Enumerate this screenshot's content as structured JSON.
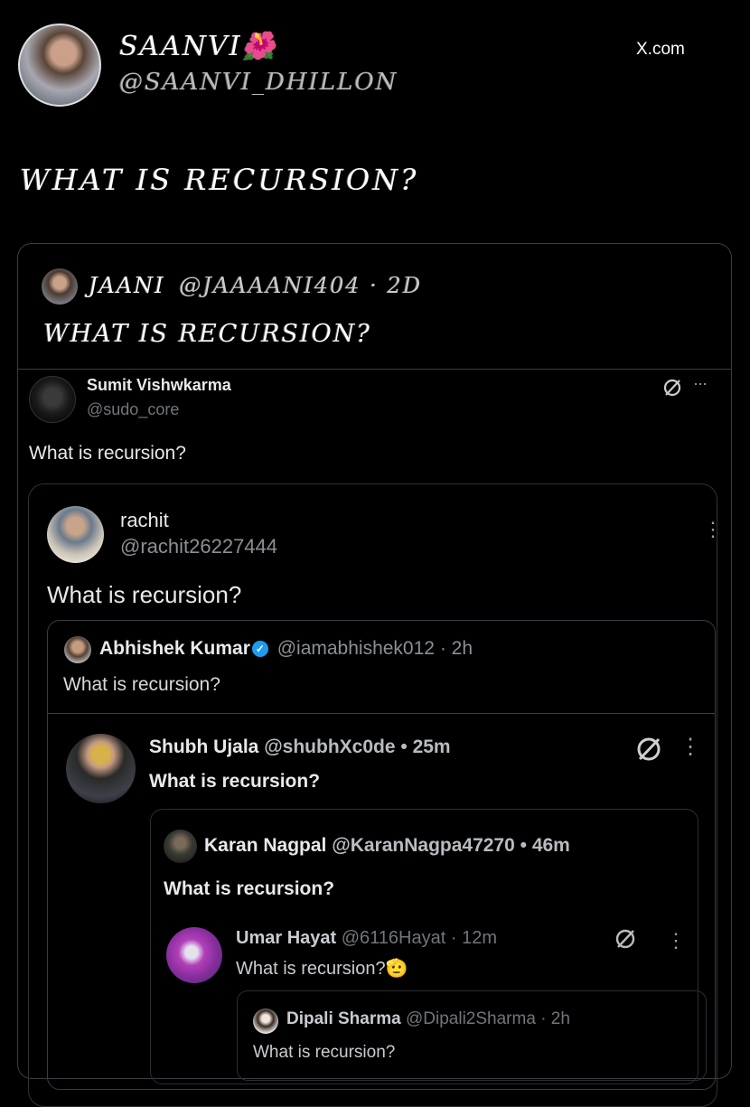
{
  "header": {
    "name": "SAANVI🌺",
    "handle": "@SAANVI_DHILLON",
    "source": "X.com"
  },
  "main_text": "WHAT IS RECURSION?",
  "quote_1": {
    "name": "JAANI",
    "handle": "@JAAAANI404",
    "meta": "· 2D",
    "text": "WHAT IS RECURSION?"
  },
  "tweet_1": {
    "name": "Sumit Vishwkarma",
    "handle": "@sudo_core",
    "text": "What is recursion?",
    "more": "···"
  },
  "tweet_2": {
    "name": "rachit",
    "handle": "@rachit26227444",
    "text": "What is recursion?",
    "more": "⋮"
  },
  "tweet_3": {
    "name": "Abhishek Kumar",
    "handle": "@iamabhishek012",
    "meta": "· 2h",
    "text": "What is recursion?"
  },
  "tweet_4": {
    "name": "Shubh Ujala",
    "handle": "@shubhXc0de",
    "meta": "• 25m",
    "text": "What is recursion?",
    "more": "⋮"
  },
  "tweet_5": {
    "name": "Karan Nagpal",
    "handle": "@KaranNagpa47270",
    "meta": "• 46m",
    "text": "What is recursion?"
  },
  "tweet_6": {
    "name": "Umar Hayat",
    "handle": "@6116Hayat",
    "meta": "· 12m",
    "text": "What is recursion?",
    "emoji": "🫡",
    "more": "⋮"
  },
  "tweet_7": {
    "name": "Dipali Sharma",
    "handle": "@Dipali2Sharma",
    "meta": "· 2h",
    "text": "What is recursion?"
  },
  "colors": {
    "background": "#000000",
    "text": "#e7e9ea",
    "muted": "#71767b",
    "border": "#2f3336",
    "verified": "#1d9bf0"
  }
}
